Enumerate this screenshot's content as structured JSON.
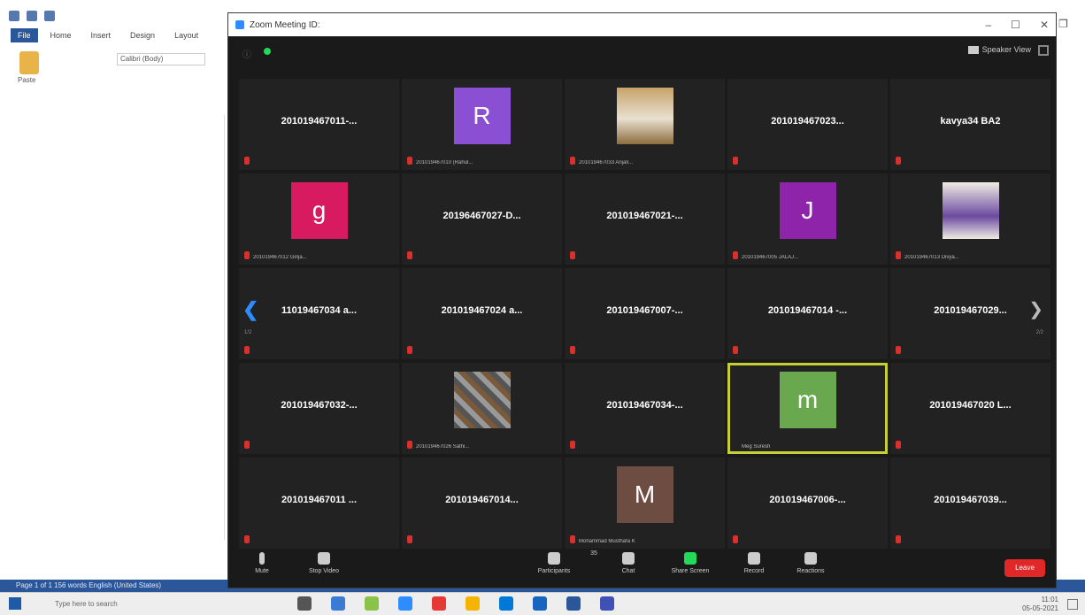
{
  "word": {
    "tabs": [
      "File",
      "Home",
      "Insert",
      "Design",
      "Layout"
    ],
    "paste_label": "Paste",
    "font_name": "Calibri (Body)",
    "status_text": "Page 1 of 1   156 words   English (United States)"
  },
  "zoom": {
    "window_title": "Zoom Meeting ID: ",
    "speaker_view_label": "Speaker View",
    "participants": [
      {
        "type": "name",
        "name": "201019467011-..."
      },
      {
        "type": "avatar",
        "letter": "R",
        "color": "#8a4fd3",
        "label": "201019467010 (Rahul..."
      },
      {
        "type": "photo",
        "label": "201019467033 Anjali..."
      },
      {
        "type": "name",
        "name": "201019467023..."
      },
      {
        "type": "name",
        "name": "kavya34 BA2"
      },
      {
        "type": "avatar",
        "letter": "g",
        "color": "#d81b60",
        "label": "201019467012 Girija..."
      },
      {
        "type": "name",
        "name": "20196467027-D..."
      },
      {
        "type": "name",
        "name": "201019467021-..."
      },
      {
        "type": "avatar",
        "letter": "J",
        "color": "#8e24aa",
        "label": "201019467005 JALAJ..."
      },
      {
        "type": "photo2",
        "label": "201019467013 Divya..."
      },
      {
        "type": "name",
        "name": "11019467034 a..."
      },
      {
        "type": "name",
        "name": "201019467024 a..."
      },
      {
        "type": "name",
        "name": "201019467007-..."
      },
      {
        "type": "name",
        "name": "201019467014 -..."
      },
      {
        "type": "name",
        "name": "201019467029..."
      },
      {
        "type": "name",
        "name": "201019467032-..."
      },
      {
        "type": "photo3",
        "label": "201019467026 Sathi..."
      },
      {
        "type": "name",
        "name": "201019467034-..."
      },
      {
        "type": "avatar",
        "letter": "m",
        "color": "#6aa84f",
        "label": "Meg Suresh",
        "active": true
      },
      {
        "type": "name",
        "name": "201019467020 L..."
      },
      {
        "type": "name",
        "name": "201019467011 ..."
      },
      {
        "type": "name",
        "name": "201019467014..."
      },
      {
        "type": "avatar",
        "letter": "M",
        "color": "#6d4c41",
        "label": "Mohammad Musthafa K"
      },
      {
        "type": "name",
        "name": "201019467006-..."
      },
      {
        "type": "name",
        "name": "201019467039..."
      }
    ],
    "page_left": "1/2",
    "page_right": "2/2",
    "toolbar": {
      "mute": "Mute",
      "video": "Stop Video",
      "participants": "Participants",
      "participants_count": "35",
      "chat": "Chat",
      "share": "Share Screen",
      "record": "Record",
      "reactions": "Reactions",
      "end": "Leave"
    }
  },
  "taskbar": {
    "search_placeholder": "Type here to search",
    "time": "11:01",
    "date": "05-05-2021"
  }
}
